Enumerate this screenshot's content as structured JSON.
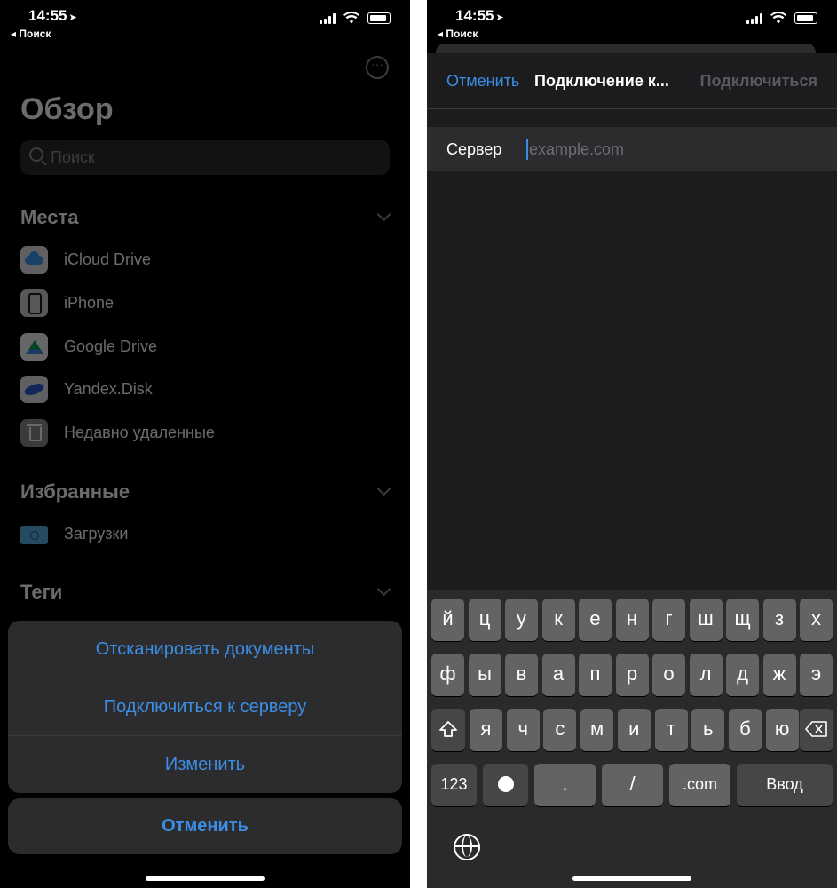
{
  "left": {
    "status": {
      "time": "14:55",
      "back": "◂ Поиск"
    },
    "title": "Обзор",
    "search_placeholder": "Поиск",
    "sections": {
      "places": "Места",
      "favorites": "Избранные",
      "tags": "Теги"
    },
    "places": [
      {
        "label": "iCloud Drive",
        "icon": "icloud-icon"
      },
      {
        "label": "iPhone",
        "icon": "iphone-icon"
      },
      {
        "label": "Google Drive",
        "icon": "google-drive-icon"
      },
      {
        "label": "Yandex.Disk",
        "icon": "yandex-disk-icon"
      },
      {
        "label": "Недавно удаленные",
        "icon": "trash-icon"
      }
    ],
    "favorites": [
      {
        "label": "Загрузки",
        "icon": "downloads-folder-icon"
      }
    ],
    "action_sheet": {
      "scan": "Отсканировать документы",
      "connect": "Подключиться к серверу",
      "edit": "Изменить",
      "cancel": "Отменить"
    }
  },
  "right": {
    "status": {
      "time": "14:55",
      "back": "◂ Поиск"
    },
    "nav": {
      "cancel": "Отменить",
      "title": "Подключение к...",
      "connect": "Подключиться"
    },
    "server_label": "Сервер",
    "server_placeholder": "example.com",
    "keyboard": {
      "row1": [
        "й",
        "ц",
        "у",
        "к",
        "е",
        "н",
        "г",
        "ш",
        "щ",
        "з",
        "х"
      ],
      "row2": [
        "ф",
        "ы",
        "в",
        "а",
        "п",
        "р",
        "о",
        "л",
        "д",
        "ж",
        "э"
      ],
      "row3": [
        "я",
        "ч",
        "с",
        "м",
        "и",
        "т",
        "ь",
        "б",
        "ю"
      ],
      "numbers": "123",
      "dot": ".",
      "slash": "/",
      "dotcom": ".com",
      "enter": "Ввод"
    }
  },
  "colors": {
    "accent": "#3b8ee4",
    "background": "#000000",
    "keyboard_key": "#636366"
  }
}
